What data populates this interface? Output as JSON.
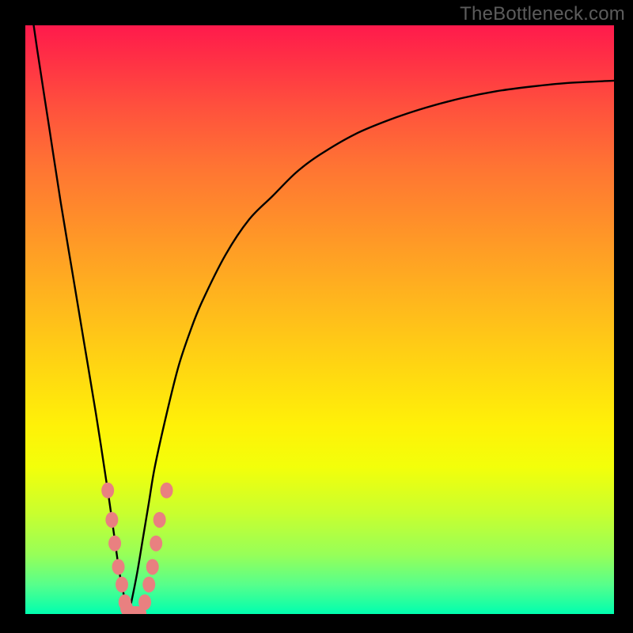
{
  "watermark": "TheBottleneck.com",
  "colors": {
    "frame": "#000000",
    "curve_stroke": "#000000",
    "marker_fill": "#e98080",
    "marker_stroke": "#d06868"
  },
  "chart_data": {
    "type": "line",
    "title": "",
    "xlabel": "",
    "ylabel": "",
    "xlim": [
      0,
      100
    ],
    "ylim": [
      0,
      100
    ],
    "grid": false,
    "series": [
      {
        "name": "bottleneck-curve",
        "x": [
          0,
          2,
          4,
          6,
          8,
          10,
          12,
          14,
          15,
          16,
          17,
          17.5,
          18,
          19,
          20,
          21,
          22,
          24,
          26,
          28,
          30,
          34,
          38,
          42,
          46,
          50,
          56,
          62,
          68,
          74,
          80,
          86,
          92,
          100
        ],
        "y": [
          110,
          96,
          83,
          70,
          58,
          46,
          34,
          21,
          14,
          7,
          2,
          0,
          2,
          7,
          13,
          19,
          25,
          34,
          42,
          48,
          53,
          61,
          67,
          71,
          75,
          78,
          81.5,
          84,
          86,
          87.6,
          88.8,
          89.6,
          90.2,
          90.6
        ]
      }
    ],
    "markers": {
      "name": "highlight-points",
      "series_ref": "bottleneck-curve",
      "points": [
        {
          "x": 14.0,
          "y": 21
        },
        {
          "x": 14.7,
          "y": 16
        },
        {
          "x": 15.2,
          "y": 12
        },
        {
          "x": 15.8,
          "y": 8
        },
        {
          "x": 16.4,
          "y": 5
        },
        {
          "x": 16.9,
          "y": 2
        },
        {
          "x": 17.2,
          "y": 1
        },
        {
          "x": 17.5,
          "y": 0
        },
        {
          "x": 18.0,
          "y": 0
        },
        {
          "x": 18.5,
          "y": 0
        },
        {
          "x": 19.0,
          "y": 0
        },
        {
          "x": 19.5,
          "y": 0
        },
        {
          "x": 20.3,
          "y": 2
        },
        {
          "x": 21.0,
          "y": 5
        },
        {
          "x": 21.6,
          "y": 8
        },
        {
          "x": 22.2,
          "y": 12
        },
        {
          "x": 22.8,
          "y": 16
        },
        {
          "x": 24.0,
          "y": 21
        }
      ],
      "radius": 8
    },
    "background_gradient": {
      "direction": "vertical",
      "stops": [
        {
          "pos": 0,
          "color": "#ff1a4c"
        },
        {
          "pos": 50,
          "color": "#ffb41e"
        },
        {
          "pos": 70,
          "color": "#fff108"
        },
        {
          "pos": 100,
          "color": "#00ffaf"
        }
      ]
    }
  }
}
